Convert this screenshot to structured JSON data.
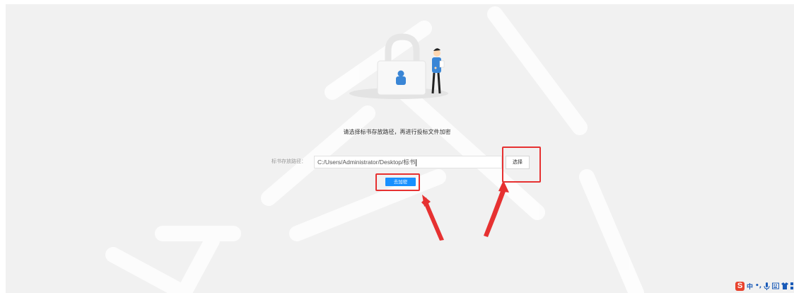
{
  "main": {
    "prompt": "请选择标书存放路径，再进行投标文件加密",
    "path_label": "标书存放路径：",
    "path_value": "C:/Users/Administrator/Desktop/标书",
    "select_button": "选择",
    "encrypt_button": "去加密"
  },
  "tray": {
    "ime_logo": "S",
    "ime_mode": "中",
    "punct": "•,",
    "items": [
      "mic-icon",
      "keyboard-icon",
      "skin-icon",
      "grid-icon"
    ]
  },
  "colors": {
    "primary": "#1890ff",
    "highlight": "#e63131",
    "panel_bg": "#f1f1f1"
  }
}
